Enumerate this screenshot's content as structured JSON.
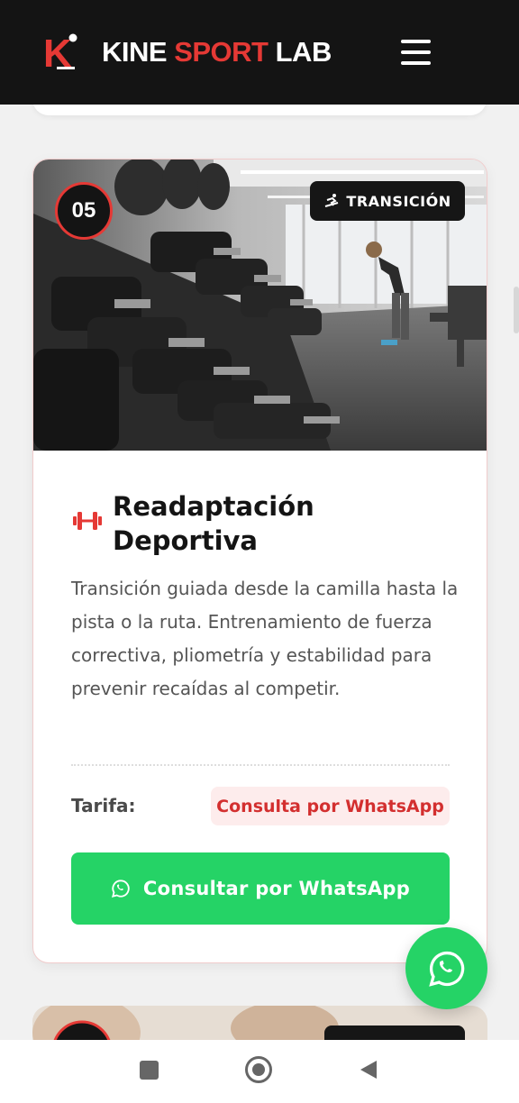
{
  "header": {
    "brand_part1": "KINE",
    "brand_part2": "SPORT",
    "brand_part3": "LAB",
    "logo_letter": "K",
    "bg_color": "#141414",
    "accent_color": "#e53935"
  },
  "card": {
    "number": "05",
    "tag_label": "TRANSICIÓN",
    "tag_icon": "snowboarder-icon",
    "title_icon": "dumbbell-icon",
    "title": "Readaptación Deportiva",
    "description": "Transición guiada desde la camilla hasta la pista o la ruta. Entrenamiento de fuerza correctiva, pliometría y estabilidad para prevenir recaídas al competir.",
    "price_label": "Tarifa:",
    "price_value": "Consulta por WhatsApp",
    "cta_label": "Consultar por WhatsApp",
    "cta_color": "#25d366"
  },
  "fab": {
    "icon": "whatsapp-icon",
    "color": "#25d366"
  },
  "system_nav": {
    "recents_icon": "square-icon",
    "home_icon": "circle-icon",
    "back_icon": "triangle-back-icon"
  }
}
